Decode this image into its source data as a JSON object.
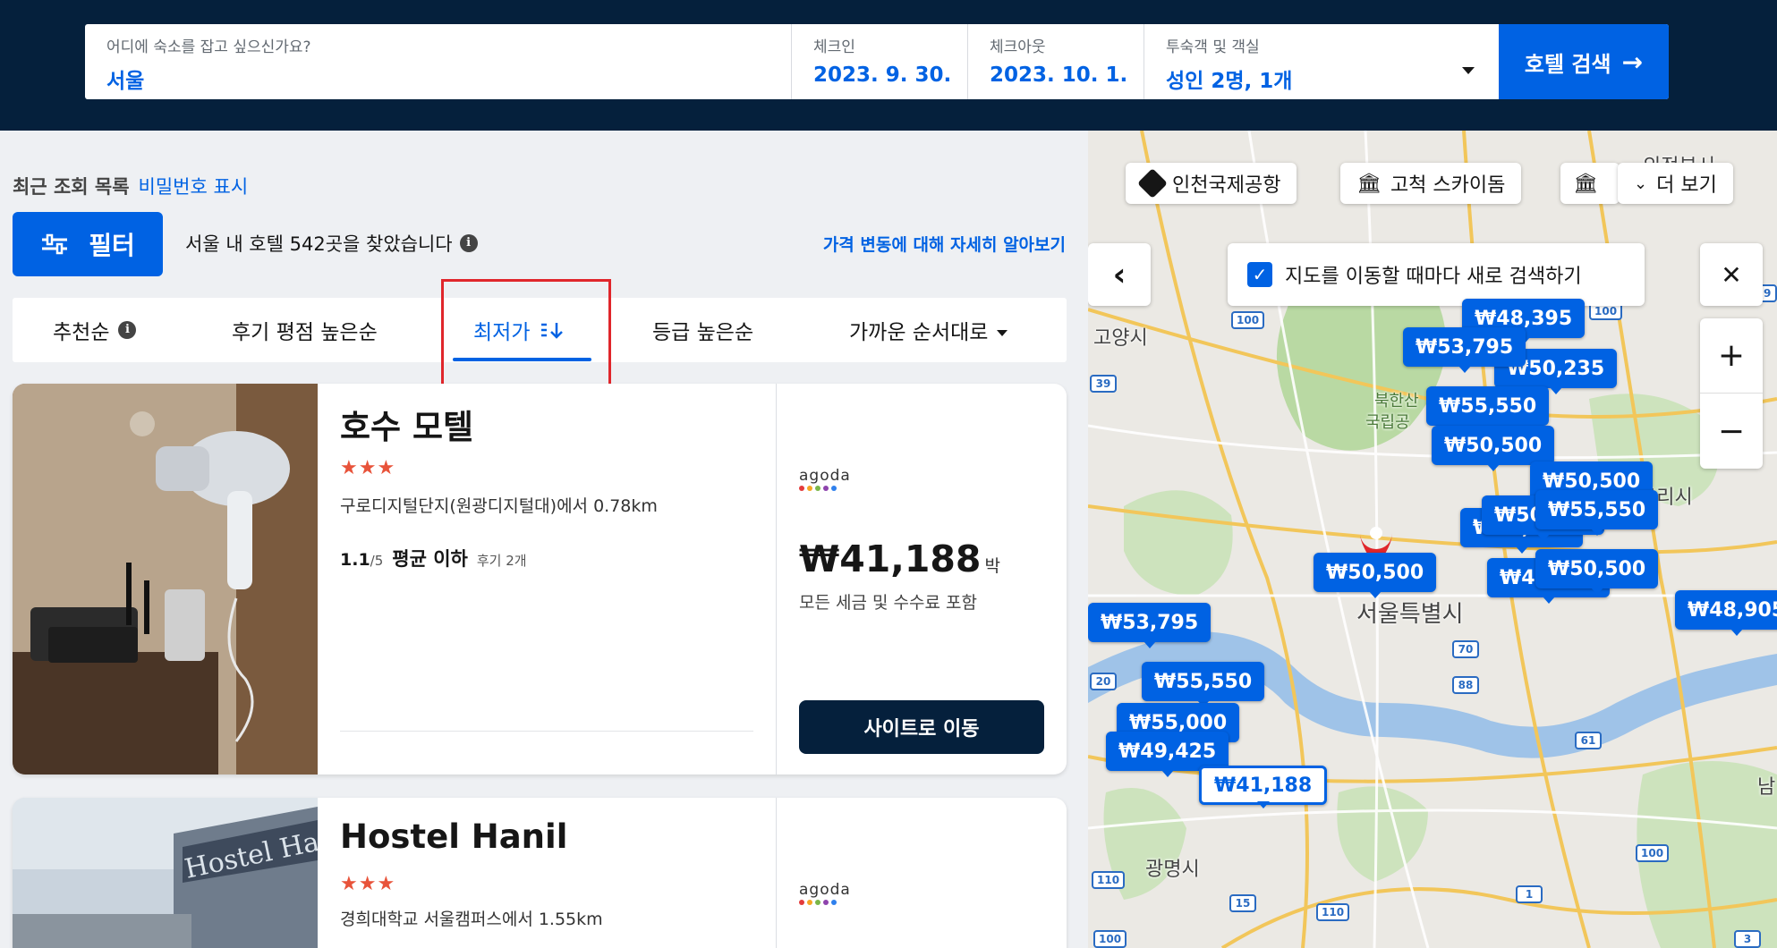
{
  "search": {
    "destination_label": "어디에 숙소를 잡고 싶으신가요?",
    "destination_value": "서울",
    "checkin_label": "체크인",
    "checkin_value": "2023. 9. 30.",
    "checkout_label": "체크아웃",
    "checkout_value": "2023. 10. 1.",
    "guests_label": "투숙객 및 객실",
    "guests_value": "성인 2명, 1개",
    "search_button": "호텔 검색",
    "search_arrow": "→"
  },
  "recent": {
    "title": "최근 조회 목록",
    "password_link": "비밀번호 표시"
  },
  "filter": {
    "label": "필터"
  },
  "results": {
    "found_text": "서울 내 호텔 542곳을 찾았습니다",
    "price_link": "가격 변동에 대해 자세히 알아보기"
  },
  "sort": {
    "tabs": [
      {
        "label": "추천순"
      },
      {
        "label": "후기 평점 높은순"
      },
      {
        "label": "최저가",
        "active": true
      },
      {
        "label": "등급 높은순"
      },
      {
        "label": "가까운 순서대로"
      }
    ]
  },
  "hotels": [
    {
      "name": "호수 모텔",
      "stars": "★★★",
      "distance": "구로디지털단지(원광디지털대)에서 0.78km",
      "score": "1.1",
      "score_max": "/5",
      "score_word": "평균 이하",
      "reviews": "후기 2개",
      "provider": "agoda",
      "price": "₩41,188",
      "price_unit": "박",
      "price_note": "모든 세금 및 수수료 포함",
      "cta": "사이트로 이동"
    },
    {
      "name": "Hostel Hanil",
      "stars": "★★★",
      "distance": "경희대학교 서울캠퍼스에서 1.55km",
      "provider": "agoda",
      "photo_sign": "Hostel Ha"
    }
  ],
  "map": {
    "chips": [
      {
        "label": "인천국제공항",
        "icon": "airport-icon"
      },
      {
        "label": "고척 스카이돔",
        "icon": "landmark-icon"
      },
      {
        "label": "",
        "icon": "landmark-icon"
      },
      {
        "label": "더 보기",
        "icon": "chevron-down-icon"
      }
    ],
    "research_label": "지도를 이동할 때마다 새로 검색하기",
    "zoom_in": "+",
    "zoom_out": "−",
    "back": "‹",
    "close": "✕",
    "place_labels": {
      "goyang": "고양시",
      "seoul": "서울특별시",
      "gwangmyeong": "광명시",
      "bukhansan": "북한산",
      "national_park": "국립공",
      "guri": "구리시",
      "uijeongbu": "의정부시",
      "nam": "남"
    },
    "highways": [
      "100",
      "39",
      "29",
      "100",
      "70",
      "88",
      "20",
      "61",
      "110",
      "100",
      "15",
      "110",
      "1",
      "100",
      "3"
    ],
    "price_markers": [
      "₩48,395",
      "₩53,795",
      "₩50,235",
      "₩55,550",
      "₩50,500",
      "₩50,500",
      "₩55,550",
      "₩50,500",
      "₩50,500",
      "₩50,500",
      "₩47,500",
      "₩50,500",
      "₩53,795",
      "₩48,905",
      "₩55,550",
      "₩55,000",
      "₩49,425",
      "₩41,188"
    ]
  }
}
